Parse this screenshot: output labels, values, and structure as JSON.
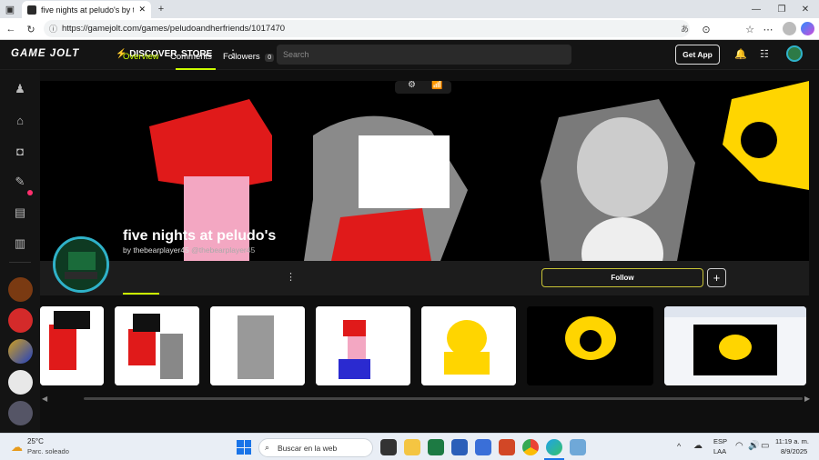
{
  "browser": {
    "tab_title": "five nights at peludo's by thebea",
    "url": "https://gamejolt.com/games/peludoandherfriends/1017470"
  },
  "site": {
    "logo": "GAME JOLT",
    "nav": {
      "discover": "DISCOVER",
      "store": "STORE"
    },
    "search_placeholder": "Search",
    "get_app": "Get App"
  },
  "game": {
    "title": "five nights at peludo's",
    "by_prefix": "by ",
    "author": "thebearplayer45",
    "author_handle": "@thebearplayer45",
    "tabs": {
      "overview": "Overview",
      "comments": "Comments",
      "followers": "Followers",
      "followers_count": "0"
    },
    "follow_label": "Follow",
    "add_label": "+"
  },
  "taskbar": {
    "weather_temp": "25°C",
    "weather_desc": "Parc. soleado",
    "search_placeholder": "Buscar en la web",
    "lang": "ESP",
    "layout": "LAA",
    "time": "11:19 a. m.",
    "date": "8/9/2025"
  },
  "colors": {
    "accent": "#c8c336",
    "avatar_ring": "#2fb2c9",
    "active_tab": "#ccff00"
  }
}
